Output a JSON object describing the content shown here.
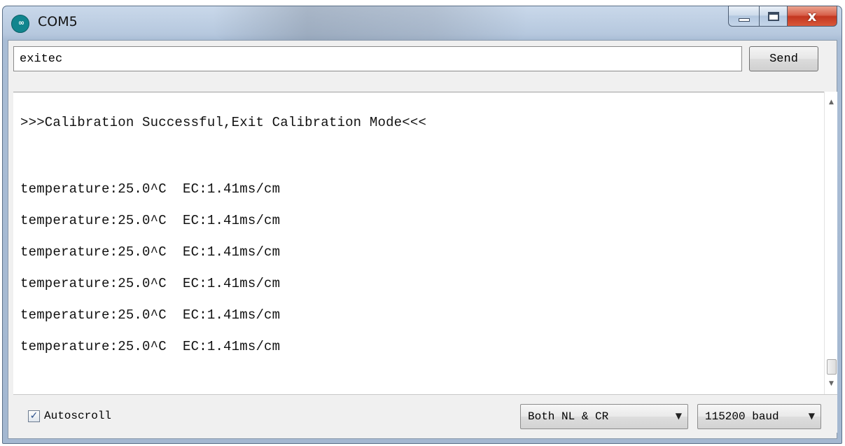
{
  "window": {
    "title": "COM5",
    "icon": "infinity-icon",
    "icon_glyph": "∞",
    "close_glyph": "x"
  },
  "input": {
    "value": "exitec"
  },
  "send": {
    "label": "Send"
  },
  "output": {
    "lines": [
      ">>>Calibration Successful,Exit Calibration Mode<<<",
      "",
      "temperature:25.0^C  EC:1.41ms/cm",
      "temperature:25.0^C  EC:1.41ms/cm",
      "temperature:25.0^C  EC:1.41ms/cm",
      "temperature:25.0^C  EC:1.41ms/cm",
      "temperature:25.0^C  EC:1.41ms/cm",
      "temperature:25.0^C  EC:1.41ms/cm"
    ]
  },
  "footer": {
    "autoscroll_label": "Autoscroll",
    "autoscroll_checked": true,
    "line_ending": "Both NL & CR",
    "baud": "115200 baud",
    "checkmark": "✓",
    "caret": "▼"
  },
  "colors": {
    "title_bar": "#b6c8de",
    "close_button": "#c3361f",
    "icon_teal": "#11858e"
  }
}
